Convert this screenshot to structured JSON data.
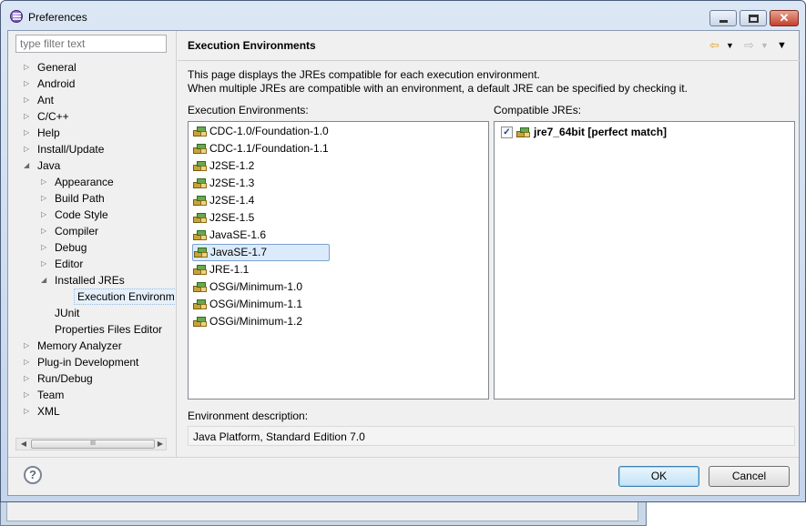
{
  "window": {
    "title": "Preferences"
  },
  "sidebar": {
    "filter_placeholder": "type filter text",
    "items": [
      {
        "label": "General",
        "level": 0,
        "expander": "collapsed"
      },
      {
        "label": "Android",
        "level": 0,
        "expander": "collapsed"
      },
      {
        "label": "Ant",
        "level": 0,
        "expander": "collapsed"
      },
      {
        "label": "C/C++",
        "level": 0,
        "expander": "collapsed"
      },
      {
        "label": "Help",
        "level": 0,
        "expander": "collapsed"
      },
      {
        "label": "Install/Update",
        "level": 0,
        "expander": "collapsed"
      },
      {
        "label": "Java",
        "level": 0,
        "expander": "expanded"
      },
      {
        "label": "Appearance",
        "level": 1,
        "expander": "collapsed"
      },
      {
        "label": "Build Path",
        "level": 1,
        "expander": "collapsed"
      },
      {
        "label": "Code Style",
        "level": 1,
        "expander": "collapsed"
      },
      {
        "label": "Compiler",
        "level": 1,
        "expander": "collapsed"
      },
      {
        "label": "Debug",
        "level": 1,
        "expander": "collapsed"
      },
      {
        "label": "Editor",
        "level": 1,
        "expander": "collapsed"
      },
      {
        "label": "Installed JREs",
        "level": 1,
        "expander": "expanded"
      },
      {
        "label": "Execution Environm",
        "level": 2,
        "expander": "none",
        "selected": true
      },
      {
        "label": "JUnit",
        "level": 1,
        "expander": "none"
      },
      {
        "label": "Properties Files Editor",
        "level": 1,
        "expander": "none"
      },
      {
        "label": "Memory Analyzer",
        "level": 0,
        "expander": "collapsed"
      },
      {
        "label": "Plug-in Development",
        "level": 0,
        "expander": "collapsed"
      },
      {
        "label": "Run/Debug",
        "level": 0,
        "expander": "collapsed"
      },
      {
        "label": "Team",
        "level": 0,
        "expander": "collapsed"
      },
      {
        "label": "XML",
        "level": 0,
        "expander": "collapsed"
      }
    ],
    "scrollbar_grip": "III"
  },
  "page": {
    "title": "Execution Environments",
    "description_line1": "This page displays the JREs compatible for each execution environment.",
    "description_line2": "When multiple JREs are compatible with an environment, a default JRE can be specified by checking it.",
    "environments_label": "Execution Environments:",
    "environments": [
      "CDC-1.0/Foundation-1.0",
      "CDC-1.1/Foundation-1.1",
      "J2SE-1.2",
      "J2SE-1.3",
      "J2SE-1.4",
      "J2SE-1.5",
      "JavaSE-1.6",
      "JavaSE-1.7",
      "JRE-1.1",
      "OSGi/Minimum-1.0",
      "OSGi/Minimum-1.1",
      "OSGi/Minimum-1.2"
    ],
    "selected_environment": "JavaSE-1.7",
    "compatible_label": "Compatible JREs:",
    "compatible_jres": [
      {
        "label": "jre7_64bit [perfect match]",
        "checked": true
      }
    ],
    "env_description_label": "Environment description:",
    "env_description_value": "Java Platform, Standard Edition 7.0"
  },
  "footer": {
    "ok_label": "OK",
    "cancel_label": "Cancel",
    "help_glyph": "?"
  },
  "icons": {
    "back": "back-arrow-icon",
    "forward": "forward-arrow-icon",
    "menu": "view-menu-icon",
    "library": "jre-library-icon"
  },
  "colors": {
    "selection": "#dcebfc",
    "ok_button": "#c3e3f7",
    "nav_arrow": "#e5a021"
  }
}
